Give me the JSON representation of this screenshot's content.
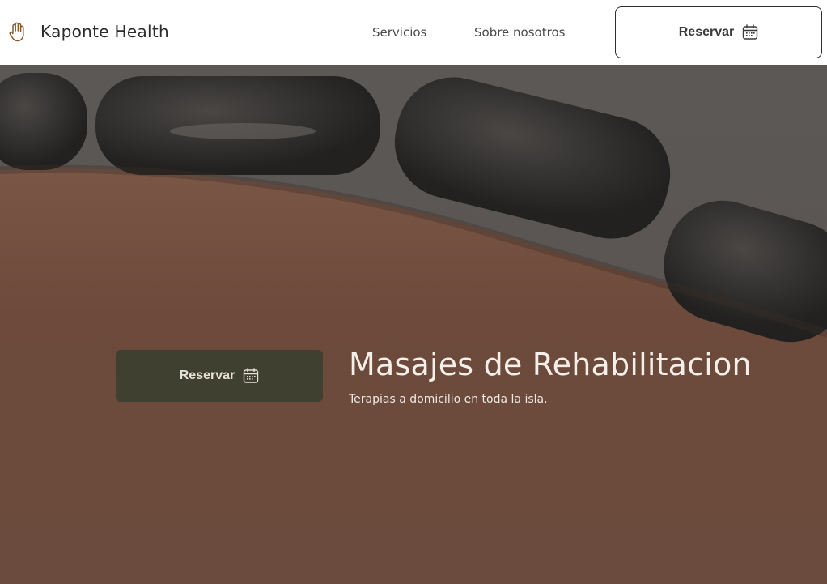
{
  "header": {
    "brand": {
      "name": "Kaponte Health",
      "icon": "hand-icon"
    },
    "nav": [
      {
        "label": "Servicios"
      },
      {
        "label": "Sobre nosotros"
      }
    ],
    "cta": {
      "label": "Reservar",
      "icon": "calendar-icon"
    }
  },
  "hero": {
    "title": "Masajes de Rehabilitacion",
    "subtitle": "Terapias a domicilio en toda la isla.",
    "cta": {
      "label": "Reservar",
      "icon": "calendar-icon"
    },
    "background_image": "hot stones on back"
  },
  "colors": {
    "header_bg": "#ffffff",
    "hero_button_bg": "#3f402f",
    "text_dark": "#2c2c2c",
    "hero_text": "#f4efe8"
  }
}
